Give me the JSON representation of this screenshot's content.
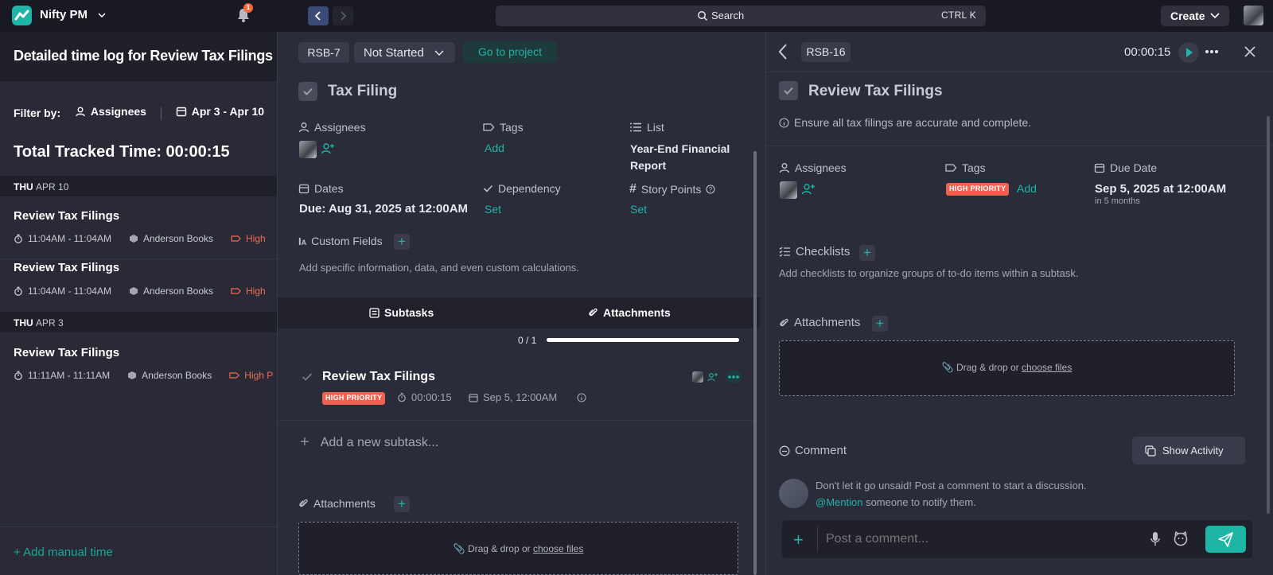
{
  "topbar": {
    "app_name": "Nifty PM",
    "notification_count": "1",
    "search_label": "Search",
    "search_shortcut": "CTRL K",
    "create_label": "Create"
  },
  "timelog": {
    "title": "Detailed time log for Review Tax Filings",
    "filter_label": "Filter by:",
    "filter_assignees": "Assignees",
    "filter_dates": "Apr 3 - Apr 10",
    "total_label": "Total Tracked Time: 00:00:15",
    "days": [
      {
        "dow": "THU",
        "date": "APR 10"
      },
      {
        "dow": "THU",
        "date": "APR 3"
      }
    ],
    "entries": [
      {
        "title": "Review Tax Filings",
        "time": "11:04AM - 11:04AM",
        "project": "Anderson Books",
        "tag": "High"
      },
      {
        "title": "Review Tax Filings",
        "time": "11:04AM - 11:04AM",
        "project": "Anderson Books",
        "tag": "High"
      },
      {
        "title": "Review Tax Filings",
        "time": "11:11AM - 11:11AM",
        "project": "Anderson Books",
        "tag": "High P"
      }
    ],
    "add_manual": "+ Add manual time"
  },
  "task": {
    "id": "RSB-7",
    "status": "Not Started",
    "goto_project": "Go to project",
    "name": "Tax Filing",
    "assignees_label": "Assignees",
    "tags_label": "Tags",
    "tags_add": "Add",
    "list_label": "List",
    "list_value": "Year-End Financial Report",
    "dates_label": "Dates",
    "dates_value": "Due: Aug 31, 2025 at 12:00AM",
    "dependency_label": "Dependency",
    "dependency_value": "Set",
    "story_points_label": "Story Points",
    "story_points_value": "Set",
    "custom_fields_label": "Custom Fields",
    "custom_fields_help": "Add specific information, data, and even custom calculations.",
    "tab_subtasks": "Subtasks",
    "tab_attachments": "Attachments",
    "progress_text": "0 / 1",
    "progress_fraction": 1,
    "subtask": {
      "title": "Review Tax Filings",
      "tag": "HIGH PRIORITY",
      "timer": "00:00:15",
      "due": "Sep 5, 12:00AM"
    },
    "add_subtask": "Add a new subtask...",
    "attachments_label": "Attachments",
    "drop_text": "Drag & drop or",
    "drop_link": "choose files"
  },
  "subtask_panel": {
    "id": "RSB-16",
    "timer": "00:00:15",
    "name": "Review Tax Filings",
    "description": "Ensure all tax filings are accurate and complete.",
    "assignees_label": "Assignees",
    "tags_label": "Tags",
    "tag": "HIGH PRIORITY",
    "tags_add": "Add",
    "due_label": "Due Date",
    "due_value": "Sep 5, 2025 at 12:00AM",
    "due_relative": "in 5 months",
    "checklists_label": "Checklists",
    "checklists_help": "Add checklists to organize groups of to-do items within a subtask.",
    "attachments_label": "Attachments",
    "drop_text": "Drag & drop or",
    "drop_link": "choose files",
    "comment_label": "Comment",
    "show_activity": "Show Activity",
    "comment_prompt": "Don't let it go unsaid! Post a comment to start a discussion.",
    "mention": "@Mention",
    "mention_rest": "someone to notify them.",
    "comment_placeholder": "Post a comment..."
  },
  "colors": {
    "accent": "#1fb5a6",
    "priority": "#f0604f",
    "notification": "#f26b3a"
  }
}
